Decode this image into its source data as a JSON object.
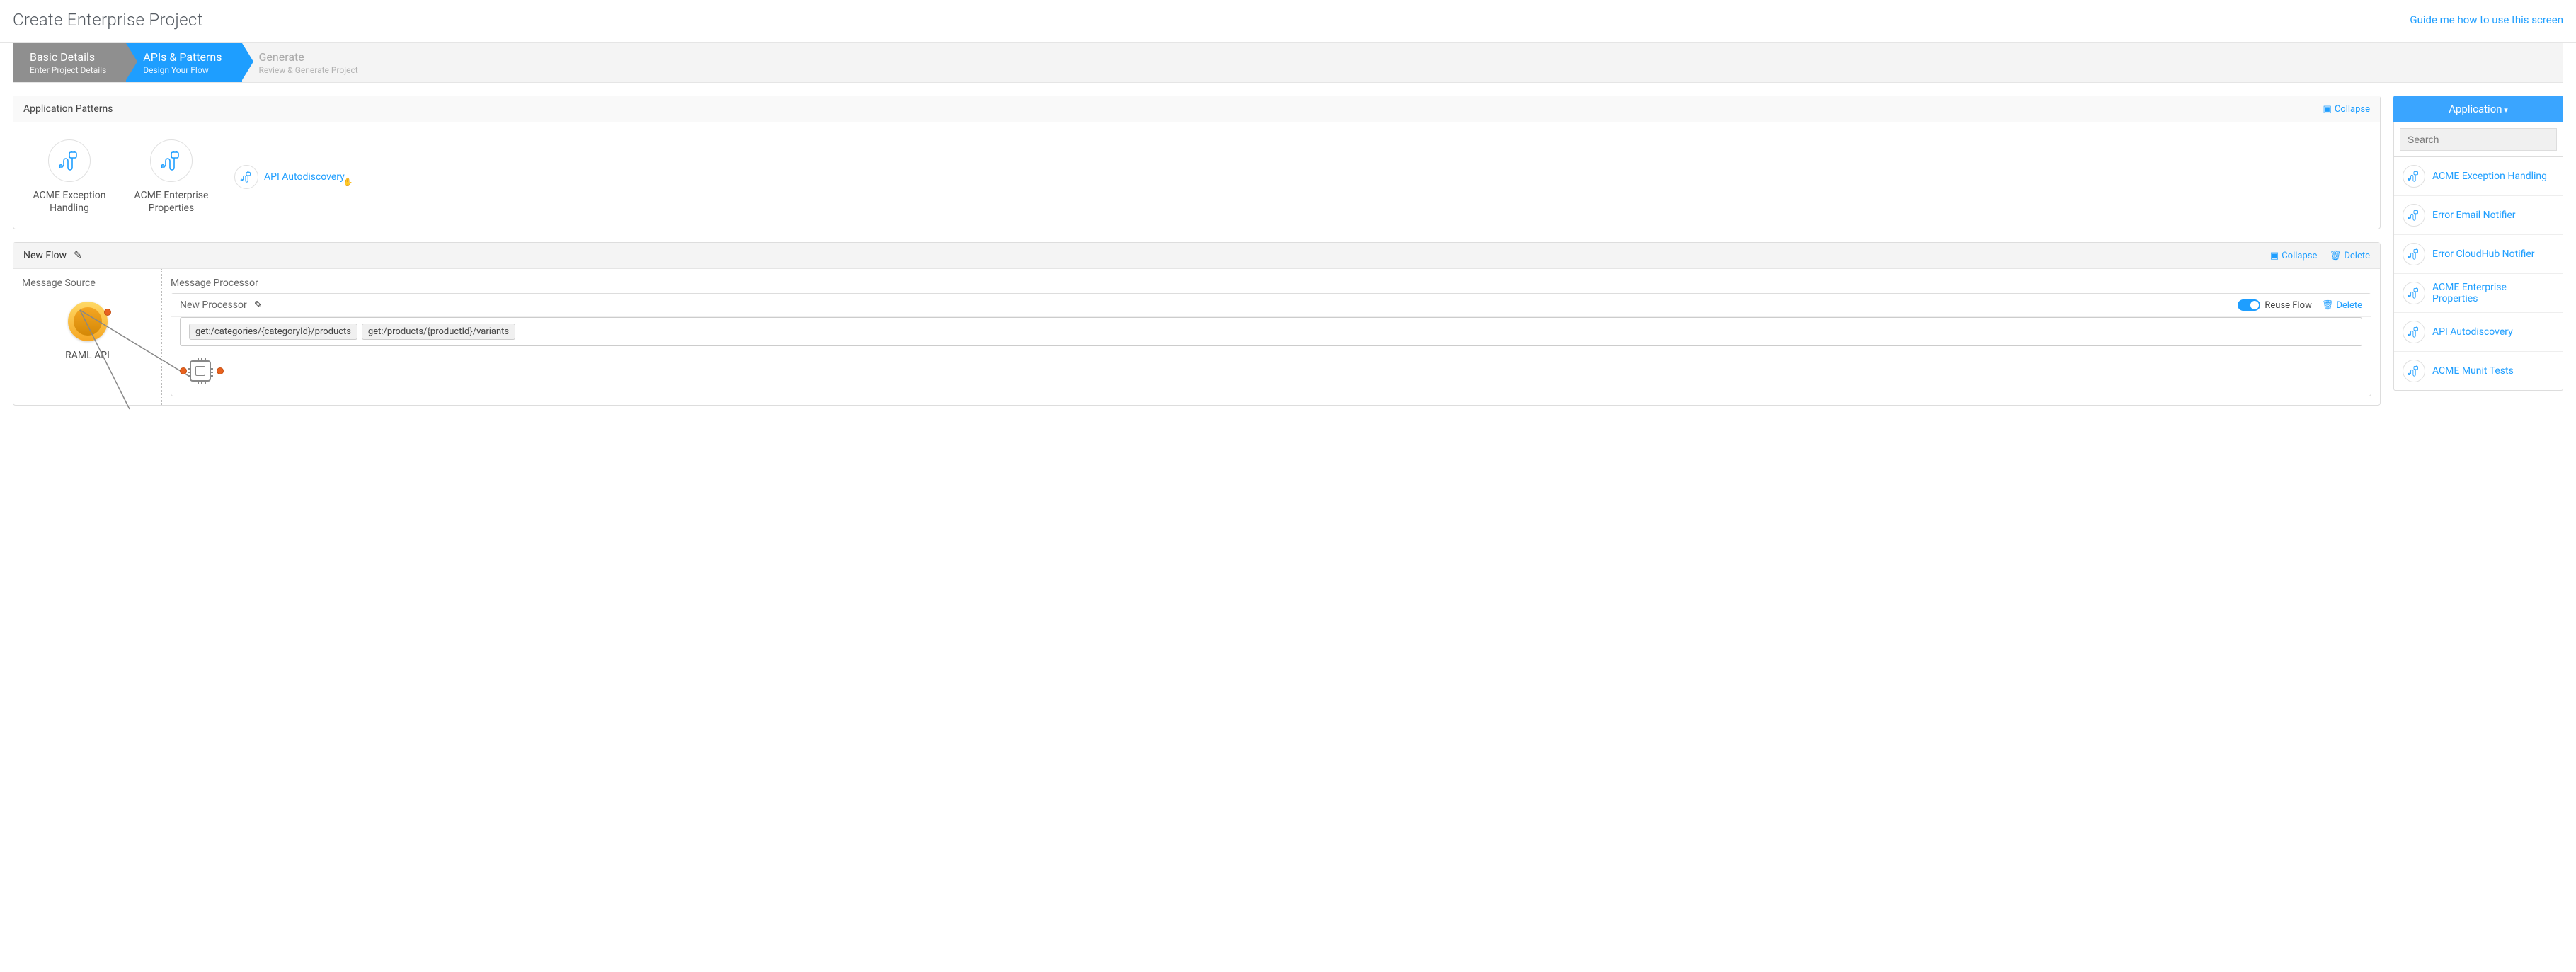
{
  "header": {
    "title": "Create Enterprise Project",
    "guide_link": "Guide me how to use this screen"
  },
  "wizard": {
    "step1": {
      "title": "Basic Details",
      "sub": "Enter Project Details"
    },
    "step2": {
      "title": "APIs & Patterns",
      "sub": "Design Your Flow"
    },
    "step3": {
      "title": "Generate",
      "sub": "Review & Generate Project"
    }
  },
  "patterns_panel": {
    "title": "Application Patterns",
    "collapse": "Collapse",
    "items": [
      {
        "label": "ACME Exception Handling"
      },
      {
        "label": "ACME Enterprise Properties"
      }
    ],
    "inline_add": "API Autodiscovery"
  },
  "flow_panel": {
    "title": "New Flow",
    "collapse": "Collapse",
    "delete": "Delete",
    "source_title": "Message Source",
    "source_label": "RAML API",
    "proc_title": "Message Processor",
    "processor": {
      "title": "New Processor",
      "reuse_label": "Reuse Flow",
      "delete": "Delete",
      "tags": [
        "get:/categories/{categoryId}/products",
        "get:/products/{productId}/variants"
      ]
    }
  },
  "sidebar": {
    "header": "Application",
    "search_placeholder": "Search",
    "items": [
      {
        "label": "ACME Exception Handling"
      },
      {
        "label": "Error Email Notifier"
      },
      {
        "label": "Error CloudHub Notifier"
      },
      {
        "label": "ACME Enterprise Properties"
      },
      {
        "label": "API Autodiscovery"
      },
      {
        "label": "ACME Munit Tests"
      }
    ]
  }
}
